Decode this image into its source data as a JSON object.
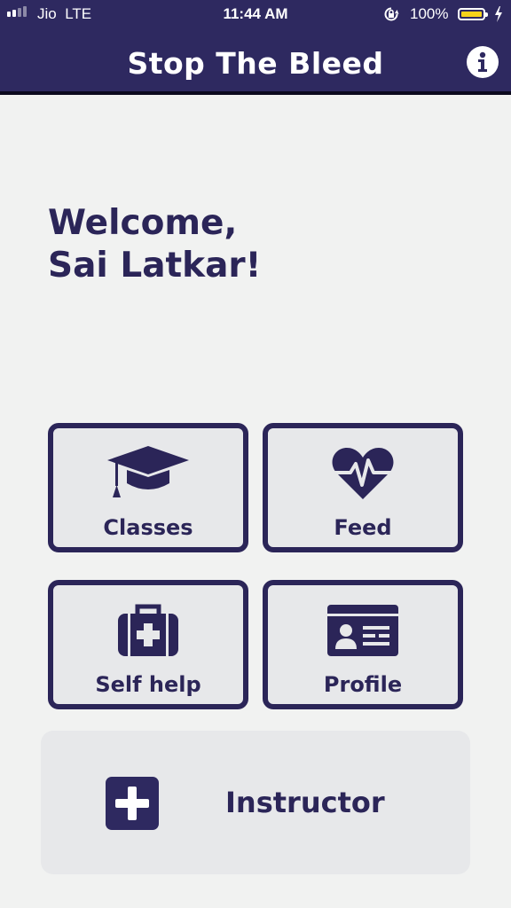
{
  "status_bar": {
    "carrier": "Jio",
    "network": "LTE",
    "time": "11:44 AM",
    "battery_percent": "100%",
    "battery_level": 1.0
  },
  "header": {
    "title": "Stop The Bleed",
    "info_icon": "info-icon"
  },
  "welcome": {
    "line1": "Welcome,",
    "line2": "Sai Latkar!"
  },
  "tiles": [
    {
      "label": "Classes",
      "icon": "graduation-cap-icon"
    },
    {
      "label": "Feed",
      "icon": "heart-pulse-icon"
    },
    {
      "label": "Self help",
      "icon": "first-aid-kit-icon"
    },
    {
      "label": "Profile",
      "icon": "id-card-icon"
    }
  ],
  "instructor": {
    "label": "Instructor",
    "icon": "plus-square-icon"
  },
  "colors": {
    "primary": "#2e2960",
    "text": "#2b2558",
    "background": "#f1f2f1",
    "tile_background": "#e7e8ea",
    "battery": "#f6d21a"
  }
}
